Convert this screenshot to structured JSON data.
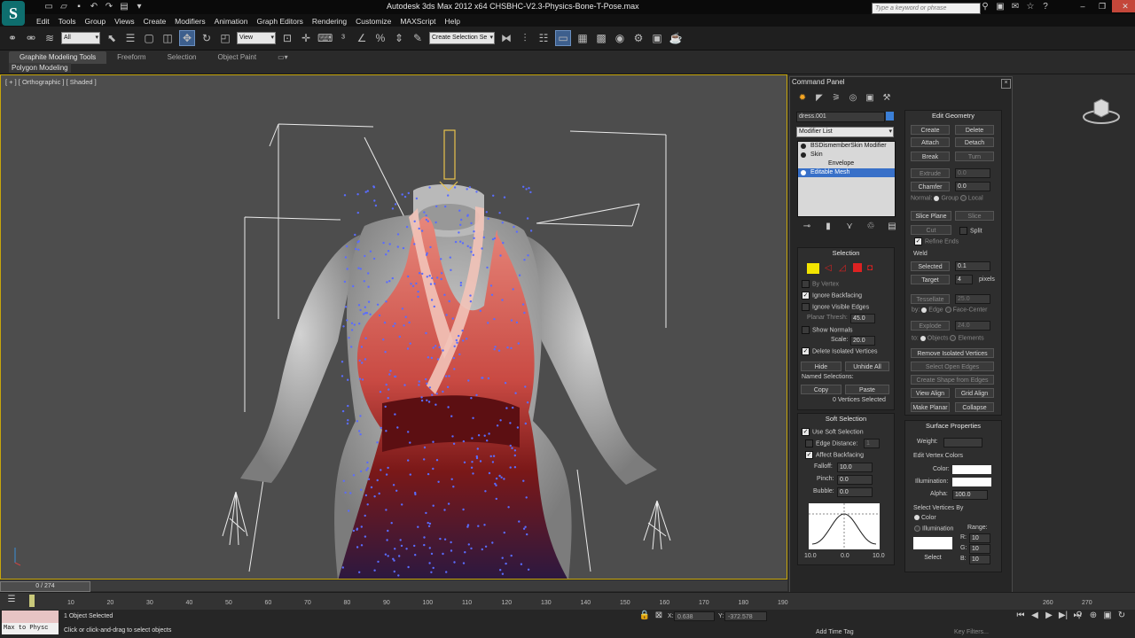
{
  "window": {
    "title": "Autodesk 3ds Max  2012 x64      CHSBHC-V2.3-Physics-Bone-T-Pose.max",
    "search_placeholder": "Type a keyword or phrase"
  },
  "menu": [
    "Edit",
    "Tools",
    "Group",
    "Views",
    "Create",
    "Modifiers",
    "Animation",
    "Graph Editors",
    "Rendering",
    "Customize",
    "MAXScript",
    "Help"
  ],
  "toolbar": {
    "selection_filter": "All",
    "reference_coord": "View",
    "named_selection": "Create Selection Se"
  },
  "ribbon": {
    "tabs": [
      "Graphite Modeling Tools",
      "Freeform",
      "Selection",
      "Object Paint"
    ],
    "panel_label": "Polygon Modeling"
  },
  "viewport": {
    "label": "[ + ] [ Orthographic ] [ Shaded ]"
  },
  "command_panel": {
    "title": "Command Panel",
    "object_name": "dress.001",
    "object_color": "#3b7fd6",
    "modifier_list": "Modifier List",
    "stack": [
      {
        "label": "BSDismemberSkin Modifier",
        "selected": false,
        "indent": false
      },
      {
        "label": "Skin",
        "selected": false,
        "indent": false
      },
      {
        "label": "Envelope",
        "selected": false,
        "indent": true
      },
      {
        "label": "Editable Mesh",
        "selected": true,
        "indent": false
      }
    ],
    "selection": {
      "title": "Selection",
      "by_vertex": "By Vertex",
      "ignore_backfacing": "Ignore Backfacing",
      "ignore_visible_edges": "Ignore Visible Edges",
      "planar_thresh_label": "Planar Thresh:",
      "planar_thresh": "45.0",
      "show_normals": "Show Normals",
      "scale_label": "Scale:",
      "scale": "20.0",
      "delete_isolated": "Delete Isolated Vertices",
      "hide": "Hide",
      "unhide_all": "Unhide All",
      "named_selections": "Named Selections:",
      "copy": "Copy",
      "paste": "Paste",
      "status": "0 Vertices Selected"
    },
    "soft_selection": {
      "title": "Soft Selection",
      "use_soft_selection": "Use Soft Selection",
      "edge_distance": "Edge Distance:",
      "edge_distance_value": "1",
      "affect_backfacing": "Affect Backfacing",
      "falloff_label": "Falloff:",
      "falloff": "10.0",
      "pinch_label": "Pinch:",
      "pinch": "0.0",
      "bubble_label": "Bubble:",
      "bubble": "0.0",
      "curve_left": "10.0",
      "curve_mid": "0.0",
      "curve_right": "10.0"
    },
    "edit_geometry": {
      "title": "Edit Geometry",
      "create": "Create",
      "delete": "Delete",
      "attach": "Attach",
      "detach": "Detach",
      "break": "Break",
      "turn": "Turn",
      "extrude": "Extrude",
      "extrude_val": "0.0",
      "chamfer": "Chamfer",
      "chamfer_val": "0.0",
      "normal_label": "Normal:",
      "group": "Group",
      "local": "Local",
      "slice_plane": "Slice Plane",
      "slice": "Slice",
      "cut": "Cut",
      "split": "Split",
      "refine_ends": "Refine Ends",
      "weld": "Weld",
      "selected": "Selected",
      "selected_val": "0.1",
      "target": "Target",
      "target_val": "4",
      "pixels": "pixels",
      "tessellate": "Tessellate",
      "tessellate_val": "25.0",
      "by_label": "by:",
      "edge": "Edge",
      "face_center": "Face-Center",
      "explode": "Explode",
      "explode_val": "24.0",
      "to_label": "to:",
      "objects": "Objects",
      "elements": "Elements",
      "remove_isolated": "Remove Isolated Vertices",
      "select_open_edges": "Select Open Edges",
      "create_shape": "Create Shape from Edges",
      "view_align": "View Align",
      "grid_align": "Grid Align",
      "make_planar": "Make Planar",
      "collapse": "Collapse"
    },
    "surface_properties": {
      "title": "Surface Properties",
      "weight": "Weight:",
      "edit_vertex_colors": "Edit Vertex Colors",
      "color": "Color:",
      "illumination": "Illumination:",
      "alpha": "Alpha:",
      "alpha_val": "100.0",
      "select_vertices_by": "Select Vertices By",
      "color_opt": "Color",
      "illum_opt": "Illumination",
      "range": "Range:",
      "r": "R:",
      "g": "G:",
      "b": "B:",
      "r_val": "10",
      "g_val": "10",
      "b_val": "10",
      "select": "Select"
    }
  },
  "timeline": {
    "frame": "0 / 274",
    "ticks": [
      "10",
      "20",
      "30",
      "40",
      "50",
      "60",
      "70",
      "80",
      "90",
      "100",
      "110",
      "120",
      "130",
      "140",
      "150",
      "160",
      "170",
      "180",
      "190"
    ],
    "right_ticks": [
      "260",
      "270"
    ]
  },
  "status": {
    "maxscript": "Max to Physc",
    "line1": "1 Object Selected",
    "line2": "Click or click-and-drag to select objects",
    "x_val": "0.638",
    "y_val": "-372.578",
    "add_time_tag": "Add Time Tag",
    "key_filters": "Key Filters..."
  }
}
